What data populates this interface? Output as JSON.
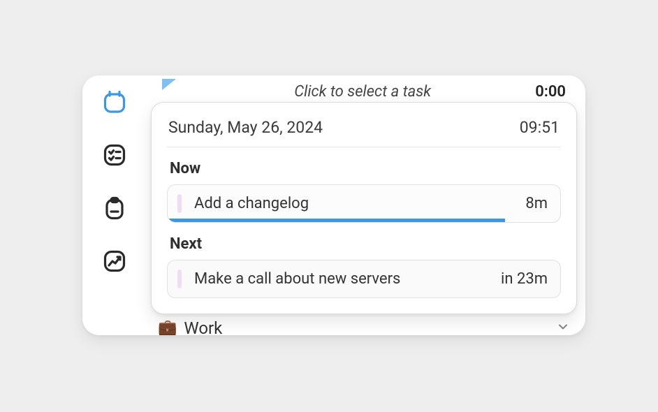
{
  "sidebar": {
    "items": [
      {
        "name": "calendar-icon",
        "active": true
      },
      {
        "name": "tasks-icon",
        "active": false
      },
      {
        "name": "clipboard-icon",
        "active": false
      },
      {
        "name": "stats-icon",
        "active": false
      }
    ]
  },
  "top": {
    "hint": "Click to select a task",
    "timer": "0:00"
  },
  "card": {
    "date": "Sunday, May 26, 2024",
    "time": "09:51",
    "now_label": "Now",
    "now_task": {
      "title": "Add a changelog",
      "meta": "8m",
      "progress_pct": 86
    },
    "next_label": "Next",
    "next_task": {
      "title": "Make a call about new servers",
      "meta": "in 23m"
    }
  },
  "below": {
    "emoji": "💼",
    "label": "Work"
  }
}
